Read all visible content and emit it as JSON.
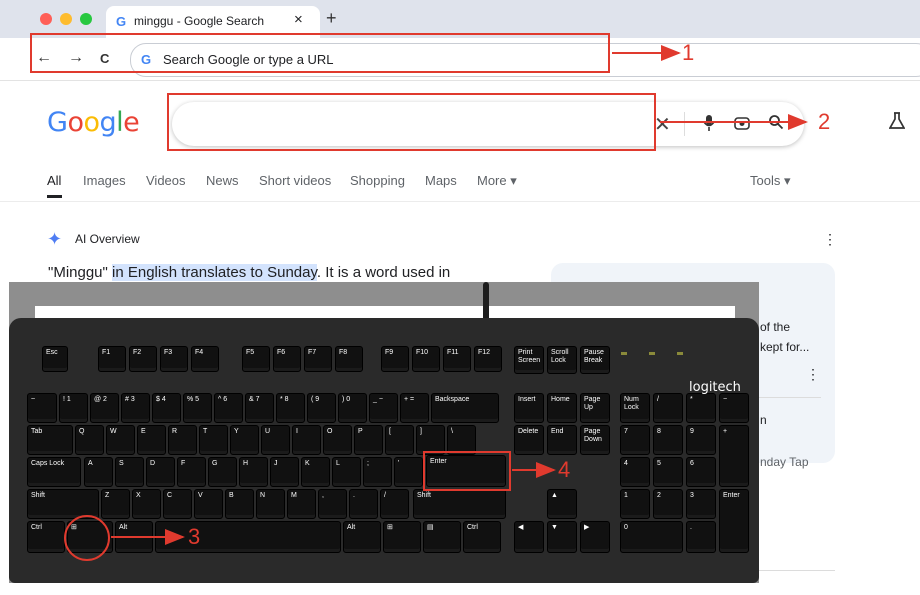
{
  "browser": {
    "tab_title": "minggu - Google Search",
    "tab_close": "×",
    "new_tab": "+",
    "omnibox_placeholder": "Search Google or type a URL",
    "nav_back": "←",
    "nav_forward": "→",
    "nav_reload": "C"
  },
  "google": {
    "logo": "Google",
    "search_value": "",
    "tabs": [
      "All",
      "Images",
      "Videos",
      "News",
      "Short videos",
      "Shopping",
      "Maps",
      "More ▾"
    ],
    "tools": "Tools ▾",
    "ai_overview_title": "AI Overview",
    "ai_text_1": "\"Minggu\" ",
    "ai_text_highlight": "in English translates to Sunday",
    "ai_text_2": ". It is a word used in",
    "side_1": "of the",
    "side_2": "kept for...",
    "side_3": "n",
    "side_4": "nday Tap"
  },
  "keyboard": {
    "brand": "logitech",
    "keys": {
      "esc": "Esc",
      "f1": "F1",
      "f2": "F2",
      "f3": "F3",
      "f4": "F4",
      "f5": "F5",
      "f6": "F6",
      "f7": "F7",
      "f8": "F8",
      "f9": "F9",
      "f10": "F10",
      "f11": "F11",
      "f12": "F12",
      "print": "Print Screen",
      "scroll": "Scroll Lock",
      "pause": "Pause Break",
      "backspace": "Backspace",
      "insert": "Insert",
      "home": "Home",
      "pageup": "Page Up",
      "numlock": "Num Lock",
      "tab": "Tab",
      "delete": "Delete",
      "end": "End",
      "pagedown": "Page Down",
      "caps": "Caps Lock",
      "enter": "Enter",
      "shift": "Shift",
      "ctrl": "Ctrl",
      "alt": "Alt",
      "win": "⊞"
    },
    "row1": [
      "1",
      "2",
      "3",
      "4",
      "5",
      "6",
      "7",
      "8",
      "9",
      "0",
      "−",
      "="
    ],
    "row1_top": [
      "!",
      "@",
      "#",
      "$",
      "%",
      "^",
      "&",
      "*",
      "(",
      ")",
      "_",
      "+"
    ],
    "row2": [
      "Q",
      "W",
      "E",
      "R",
      "T",
      "Y",
      "U",
      "I",
      "O",
      "P",
      "[",
      "]",
      "\\"
    ],
    "row3": [
      "A",
      "S",
      "D",
      "F",
      "G",
      "H",
      "J",
      "K",
      "L",
      ";",
      "'"
    ],
    "row4": [
      "Z",
      "X",
      "C",
      "V",
      "B",
      "N",
      "M",
      ",",
      ".",
      "/"
    ],
    "numpad": [
      "7",
      "8",
      "9",
      "4",
      "5",
      "6",
      "1",
      "2",
      "3",
      "0"
    ]
  },
  "annotations": {
    "labels": [
      "1",
      "2",
      "3",
      "4"
    ],
    "color": "#e03a2e"
  },
  "colors": {
    "google_blue": "#4285f4",
    "google_red": "#ea4335",
    "google_yellow": "#fbbc05",
    "google_green": "#34a853",
    "highlight": "#d3e3fd",
    "annotation": "#e03a2e"
  }
}
